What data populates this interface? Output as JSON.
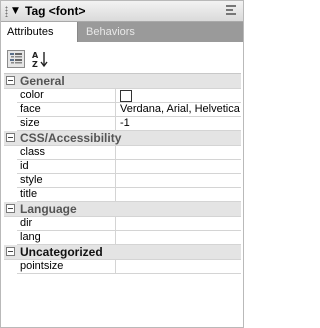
{
  "panel": {
    "title": "Tag <font>",
    "collapse_glyph": "▼",
    "options_icon": "panel-options-icon"
  },
  "tabs": [
    {
      "label": "Attributes",
      "active": true
    },
    {
      "label": "Behaviors",
      "active": false
    }
  ],
  "toolbar": {
    "category_view_icon": "category-view-icon",
    "sort_az_icon": "sort-az-icon"
  },
  "categories": {
    "general": {
      "label": "General",
      "properties": {
        "color": {
          "name": "color",
          "value": ""
        },
        "face": {
          "name": "face",
          "value": "Verdana, Arial, Helvetica"
        },
        "size": {
          "name": "size",
          "value": "-1"
        }
      }
    },
    "css": {
      "label": "CSS/Accessibility",
      "properties": {
        "class": {
          "name": "class",
          "value": ""
        },
        "id": {
          "name": "id",
          "value": ""
        },
        "style": {
          "name": "style",
          "value": ""
        },
        "title": {
          "name": "title",
          "value": ""
        }
      }
    },
    "language": {
      "label": "Language",
      "properties": {
        "dir": {
          "name": "dir",
          "value": ""
        },
        "lang": {
          "name": "lang",
          "value": ""
        }
      }
    },
    "uncategorized": {
      "label": "Uncategorized",
      "properties": {
        "pointsize": {
          "name": "pointsize",
          "value": ""
        }
      }
    }
  },
  "colors": {
    "tabstrip": "#9a9a9a",
    "category_bg": "#e4e4e4",
    "grid_line": "#d4d4d4"
  }
}
